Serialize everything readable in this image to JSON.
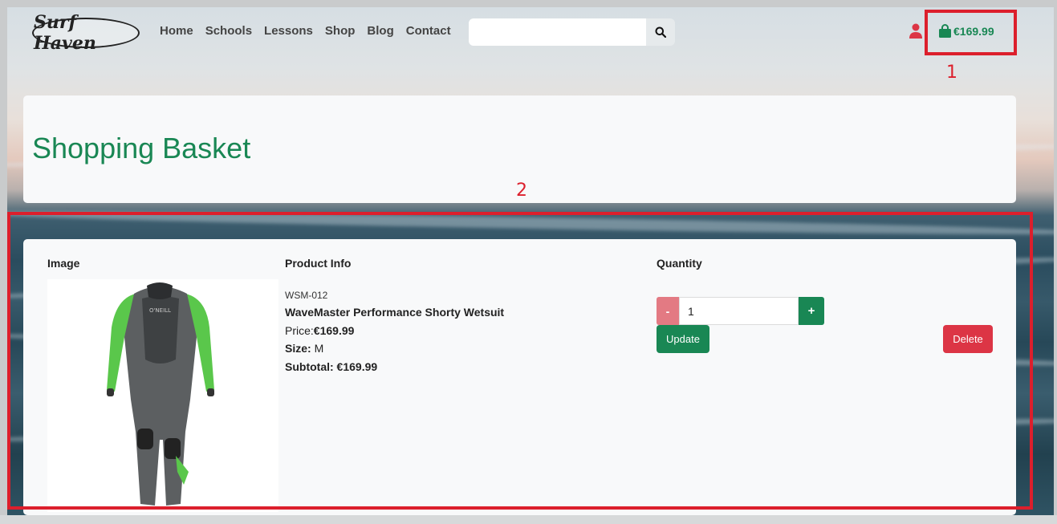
{
  "brand": {
    "logo_text": "Surf Haven"
  },
  "nav": {
    "items": [
      {
        "label": "Home"
      },
      {
        "label": "Schools"
      },
      {
        "label": "Lessons"
      },
      {
        "label": "Shop"
      },
      {
        "label": "Blog"
      },
      {
        "label": "Contact"
      }
    ]
  },
  "search": {
    "value": "",
    "placeholder": ""
  },
  "account": {
    "icon": "user-icon",
    "color": "#dc3545"
  },
  "basket": {
    "icon": "shopping-bag-icon",
    "total": "€169.99",
    "color": "#198754"
  },
  "annotations": {
    "label_1": "1",
    "label_2": "2",
    "color": "#dc1f2c"
  },
  "page": {
    "title": "Shopping Basket",
    "title_color": "#198754"
  },
  "table": {
    "headers": {
      "image": "Image",
      "product_info": "Product Info",
      "quantity": "Quantity"
    },
    "items": [
      {
        "sku": "WSM-012",
        "name": "WaveMaster Performance Shorty Wetsuit",
        "price_label": "Price:",
        "price": "€169.99",
        "size_label": "Size:",
        "size": "M",
        "subtotal_label": "Subtotal:",
        "subtotal": "€169.99",
        "quantity": "1",
        "minus_label": "-",
        "plus_label": "+",
        "update_label": "Update",
        "delete_label": "Delete",
        "image_brand_text": "O'NEILL"
      }
    ]
  }
}
